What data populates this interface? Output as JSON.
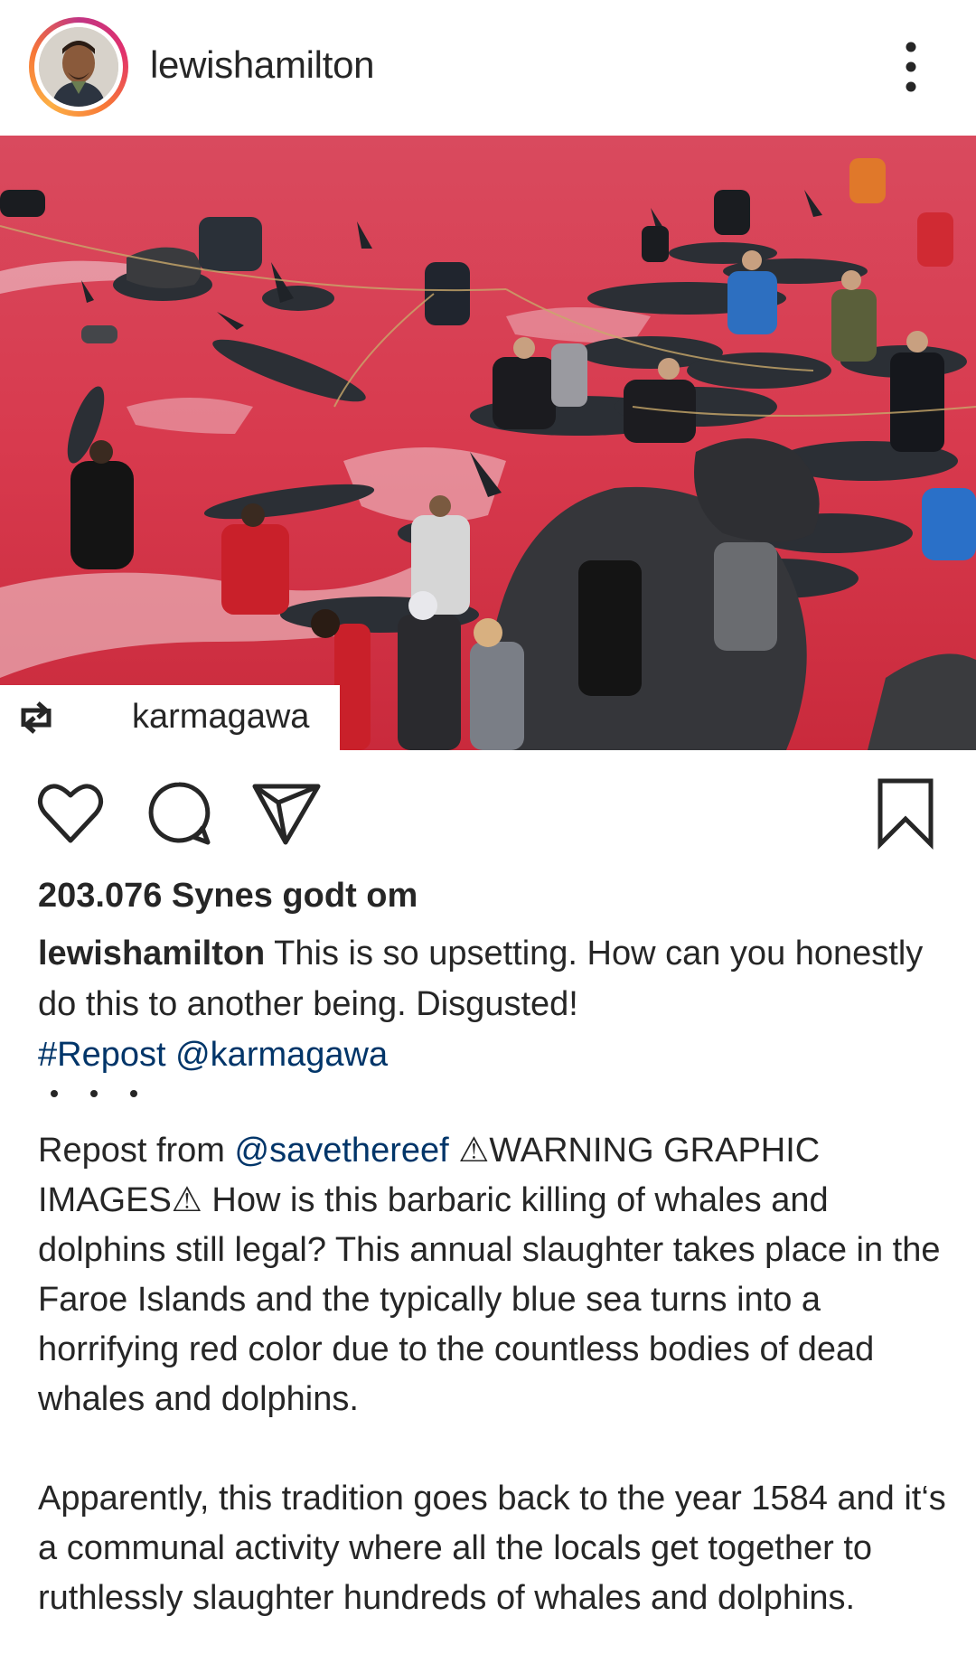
{
  "header": {
    "username": "lewishamilton",
    "more_icon": "more-vertical-icon"
  },
  "post": {
    "image_description_icon": "photo",
    "repost_icon": "repost-icon",
    "repost_username": "karmagawa"
  },
  "actions": {
    "like_icon": "heart-icon",
    "comment_icon": "comment-icon",
    "share_icon": "send-icon",
    "save_icon": "bookmark-icon"
  },
  "likes": "203.076 Synes godt om",
  "caption": {
    "username": "lewishamilton",
    "text": "This is so upsetting. How can you honestly do this to another being. Disgusted!",
    "hashtag": "#Repost",
    "mention": "@karmagawa"
  },
  "body": {
    "prefix": "Repost from",
    "mention": "@savethereef",
    "paragraph1_rest": "⚠WARNING GRAPHIC IMAGES⚠ How is this barbaric killing of whales and dolphins still legal? This annual slaughter takes place in the Faroe Islands and the typically blue sea turns into a horrifying red color due to the countless bodies of dead whales and dolphins.",
    "paragraph2": "Apparently, this tradition goes back to the year 1584 and it‘s a communal activity where all the locals get together to ruthlessly slaughter hundreds of whales and dolphins."
  },
  "colors": {
    "text": "#262626",
    "link": "#003569",
    "sea_red": "#d83a4e"
  }
}
